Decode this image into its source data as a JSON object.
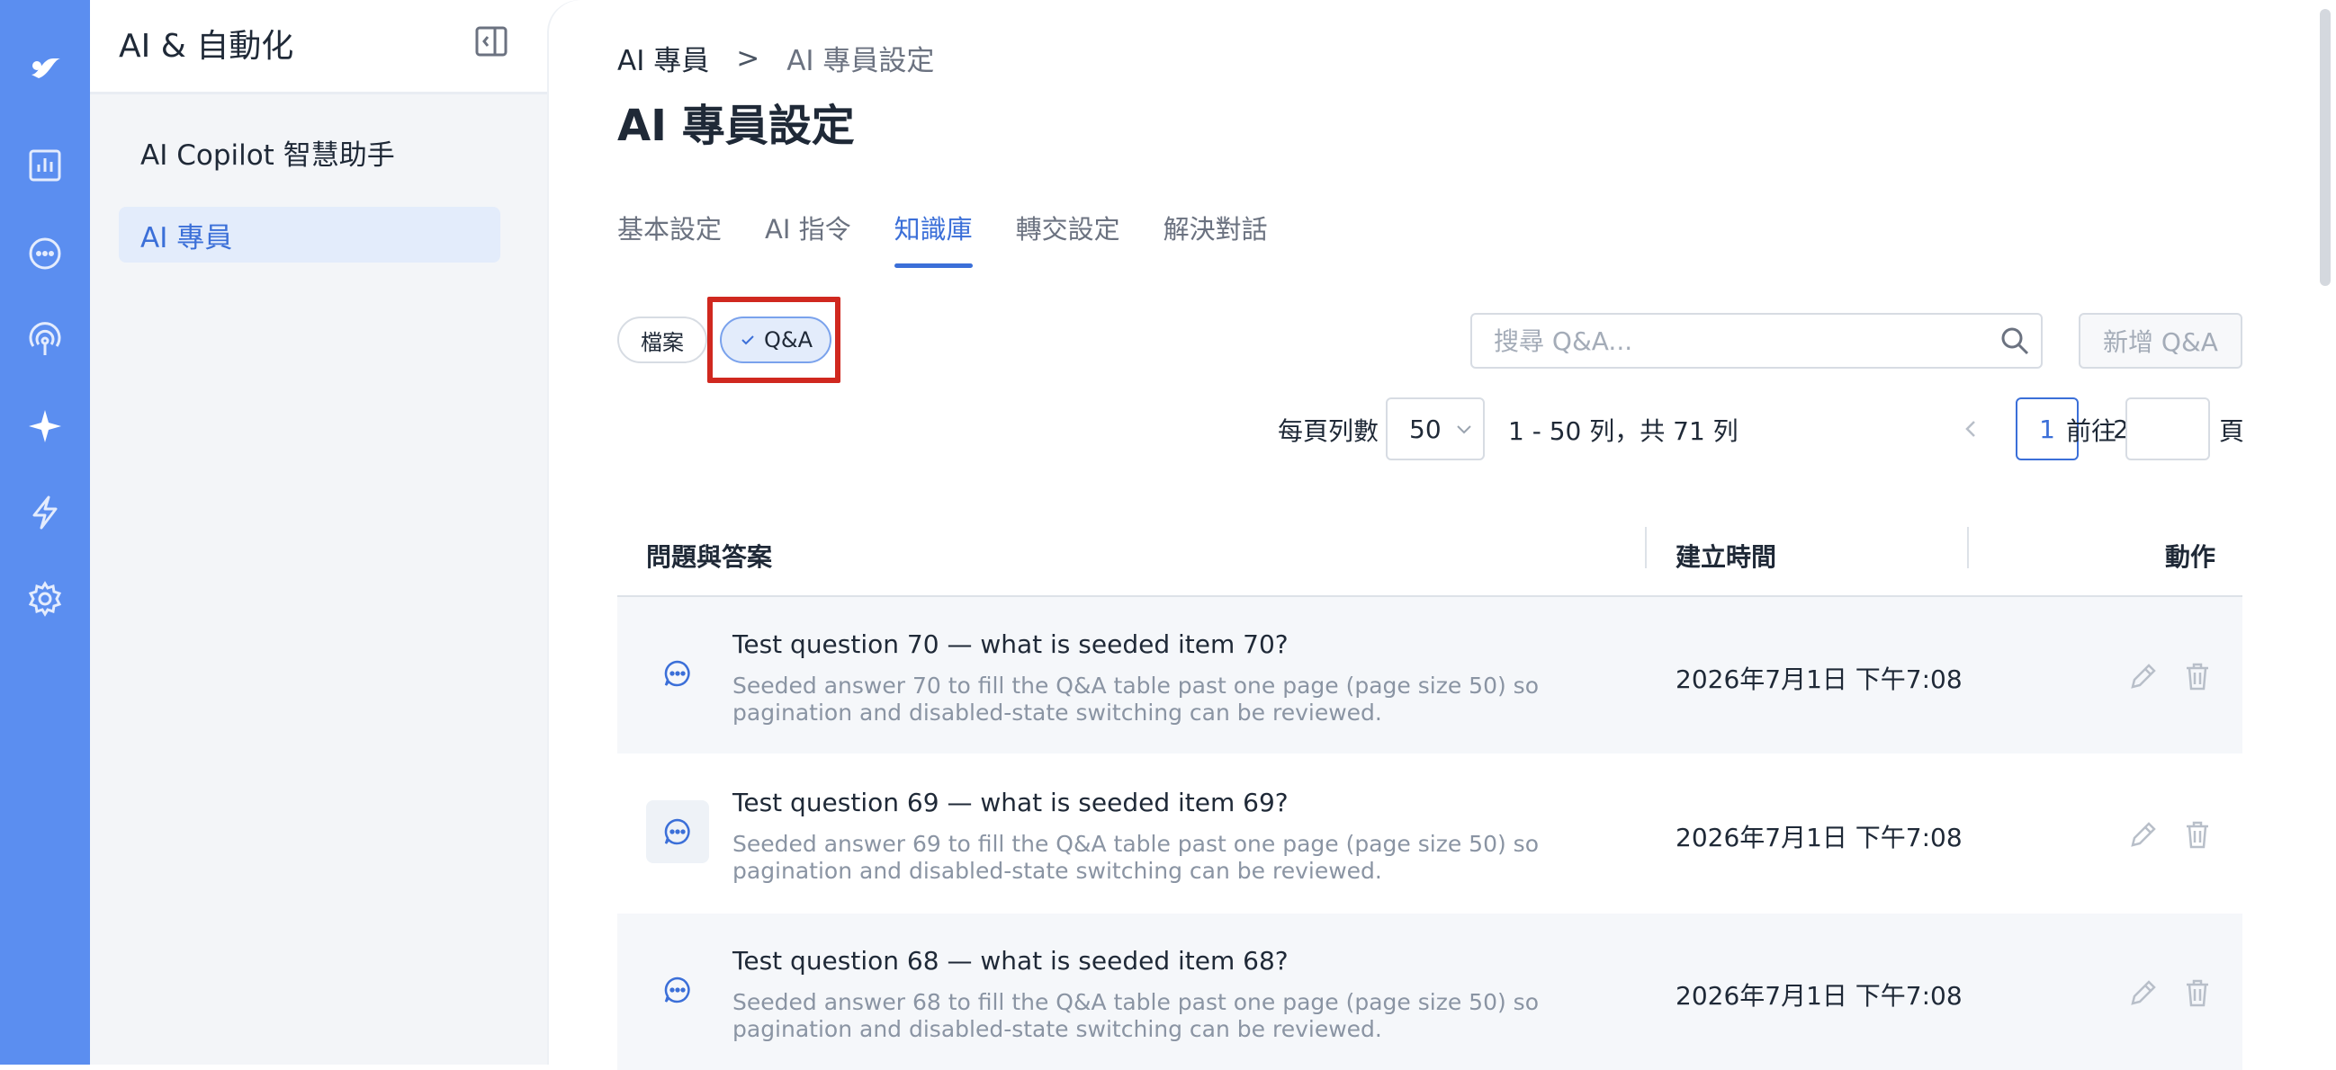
{
  "rail": {
    "icons": [
      "logo-icon",
      "analytics-icon",
      "chat-icon",
      "broadcast-icon",
      "ai-sparkle-icon",
      "automation-bolt-icon",
      "settings-gear-icon"
    ]
  },
  "sidebar": {
    "title": "AI & 自動化",
    "items": [
      {
        "label": "AI Copilot 智慧助手",
        "active": false
      },
      {
        "label": "AI 專員",
        "active": true
      }
    ]
  },
  "header": {
    "breadcrumb": [
      "AI 專員",
      ">",
      "AI 專員設定"
    ],
    "title": "AI 專員設定"
  },
  "tabs": [
    {
      "label": "基本設定",
      "active": false
    },
    {
      "label": "AI 指令",
      "active": false
    },
    {
      "label": "知識庫",
      "active": true
    },
    {
      "label": "轉交設定",
      "active": false
    },
    {
      "label": "解決對話",
      "active": false
    }
  ],
  "filters": {
    "file_label": "檔案",
    "qa_label": "Q&A",
    "qa_selected": true
  },
  "search": {
    "placeholder": "搜尋 Q&A..."
  },
  "add_button": "新增 Q&A",
  "pagination": {
    "rows_per_page_label": "每頁列數",
    "rows_per_page": "50",
    "range_text": "1 - 50 列，共 71 列",
    "pages": [
      "1",
      "2"
    ],
    "current_page": "1",
    "goto_label": "前往",
    "page_suffix": "頁"
  },
  "table": {
    "columns": [
      "問題與答案",
      "建立時間",
      "動作"
    ],
    "rows": [
      {
        "question": "Test question 70 — what is seeded item 70?",
        "answer": "Seeded answer 70 to fill the Q&A table past one page (page size 50) so pagination and disabled-state switching can be reviewed.",
        "created": "2026年7月1日 下午7:08"
      },
      {
        "question": "Test question 69 — what is seeded item 69?",
        "answer": "Seeded answer 69 to fill the Q&A table past one page (page size 50) so pagination and disabled-state switching can be reviewed.",
        "created": "2026年7月1日 下午7:08"
      },
      {
        "question": "Test question 68 — what is seeded item 68?",
        "answer": "Seeded answer 68 to fill the Q&A table past one page (page size 50) so pagination and disabled-state switching can be reviewed.",
        "created": "2026年7月1日 下午7:08"
      }
    ]
  },
  "colors": {
    "rail": "#5b8ef0",
    "accent": "#3b6fd8",
    "highlight": "#d0281f"
  }
}
